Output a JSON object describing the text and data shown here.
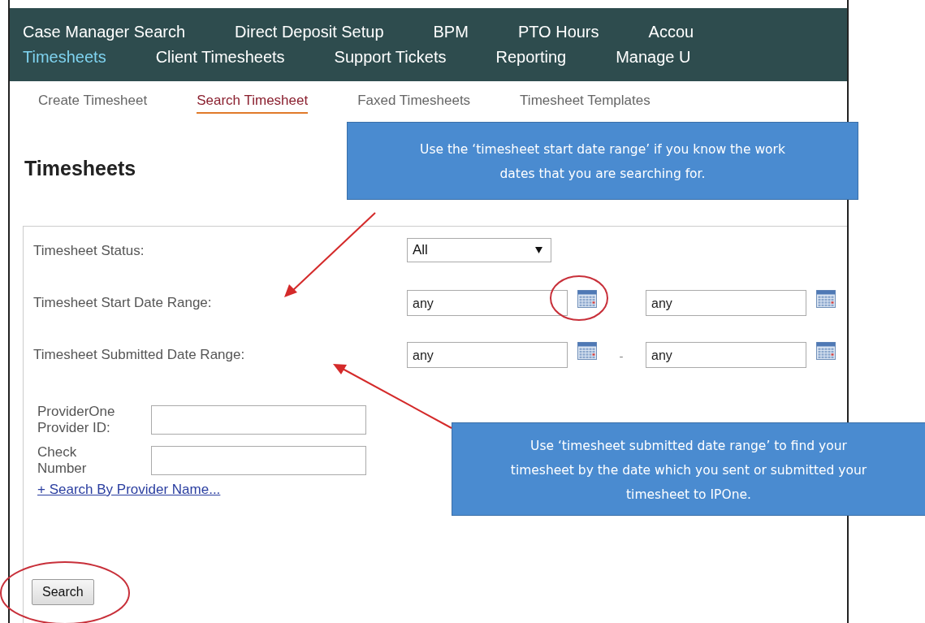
{
  "nav": {
    "rows": [
      [
        {
          "label": "Case Manager Search",
          "selected": false
        },
        {
          "label": "Direct Deposit Setup",
          "selected": false
        },
        {
          "label": "BPM",
          "selected": false
        },
        {
          "label": "PTO Hours",
          "selected": false
        },
        {
          "label": "Accou",
          "selected": false
        }
      ],
      [
        {
          "label": "Timesheets",
          "selected": true
        },
        {
          "label": "Client Timesheets",
          "selected": false
        },
        {
          "label": "Support Tickets",
          "selected": false
        },
        {
          "label": "Reporting",
          "selected": false
        },
        {
          "label": "Manage U",
          "selected": false
        }
      ]
    ]
  },
  "tabs": [
    {
      "label": "Create Timesheet",
      "selected": false
    },
    {
      "label": "Search Timesheet",
      "selected": true
    },
    {
      "label": "Faxed Timesheets",
      "selected": false
    },
    {
      "label": "Timesheet Templates",
      "selected": false
    }
  ],
  "title": "Timesheets",
  "filters": [
    {
      "kind": "select",
      "label": "Timesheet Status:",
      "value": "All"
    },
    {
      "kind": "range",
      "label": "Timesheet Start Date Range:",
      "from": "any",
      "to": "any"
    },
    {
      "kind": "range",
      "label": "Timesheet Submitted Date Range:",
      "from": "any",
      "separator": "-",
      "to": "any"
    }
  ],
  "id_fields": [
    {
      "label": "ProviderOne Provider ID:"
    },
    {
      "label": "Check Number"
    }
  ],
  "link": "+ Search By Provider Name...",
  "search_button": "Search",
  "callouts": [
    {
      "text": "Use the ‘timesheet start date range’ if you know the work dates that you are searching for."
    },
    {
      "text": "Use ‘timesheet submitted date range’ to find your timesheet by the date which you sent or submitted your timesheet to IPOne."
    }
  ]
}
